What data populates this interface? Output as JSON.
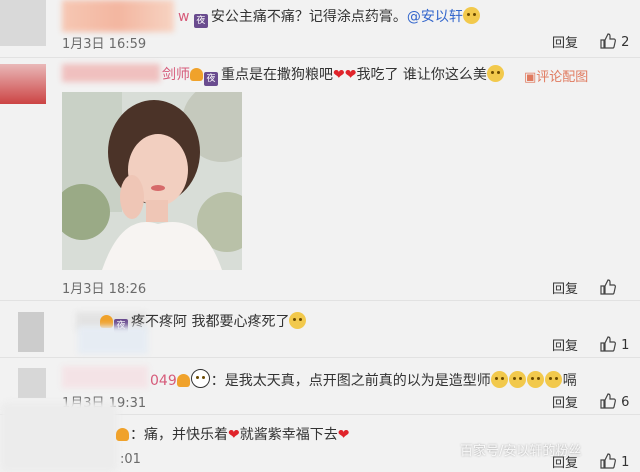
{
  "comments": [
    {
      "user_tail": "w",
      "text": "安公主痛不痛？记得涂点药膏。",
      "mention": "@安以轩",
      "time": "1月3日 16:59",
      "reply": "回复",
      "likes": "2"
    },
    {
      "user_tail": "剑师",
      "text_a": "重点是在撒狗粮吧",
      "text_b": "我吃了 谁让你这么美",
      "extra": "评论配图",
      "time": "1月3日 18:26",
      "reply": "回复",
      "likes": ""
    },
    {
      "text": "疼不疼阿 我都要心疼死了",
      "time": "",
      "reply": "回复",
      "likes": "1"
    },
    {
      "user_tail": "049",
      "text": "：是我太天真，点开图之前真的以为是造型师",
      "text_end": "嗝",
      "time": "1月3日 19:31",
      "reply": "回复",
      "likes": "6"
    },
    {
      "text": "：痛，并快乐着",
      "text_b": "就酱紫幸福下去",
      "time": ":01",
      "reply": "回复",
      "likes": "1"
    }
  ],
  "watermark": "百家号/安以轩的粉丝",
  "colors": {
    "heart": "#e0242b",
    "background": "#f2f2f2"
  },
  "icons": [
    "vip-icon",
    "thumbs-up-icon",
    "heart-icon",
    "smile-emoji-icon",
    "picture-icon",
    "panda-emoji-icon"
  ]
}
